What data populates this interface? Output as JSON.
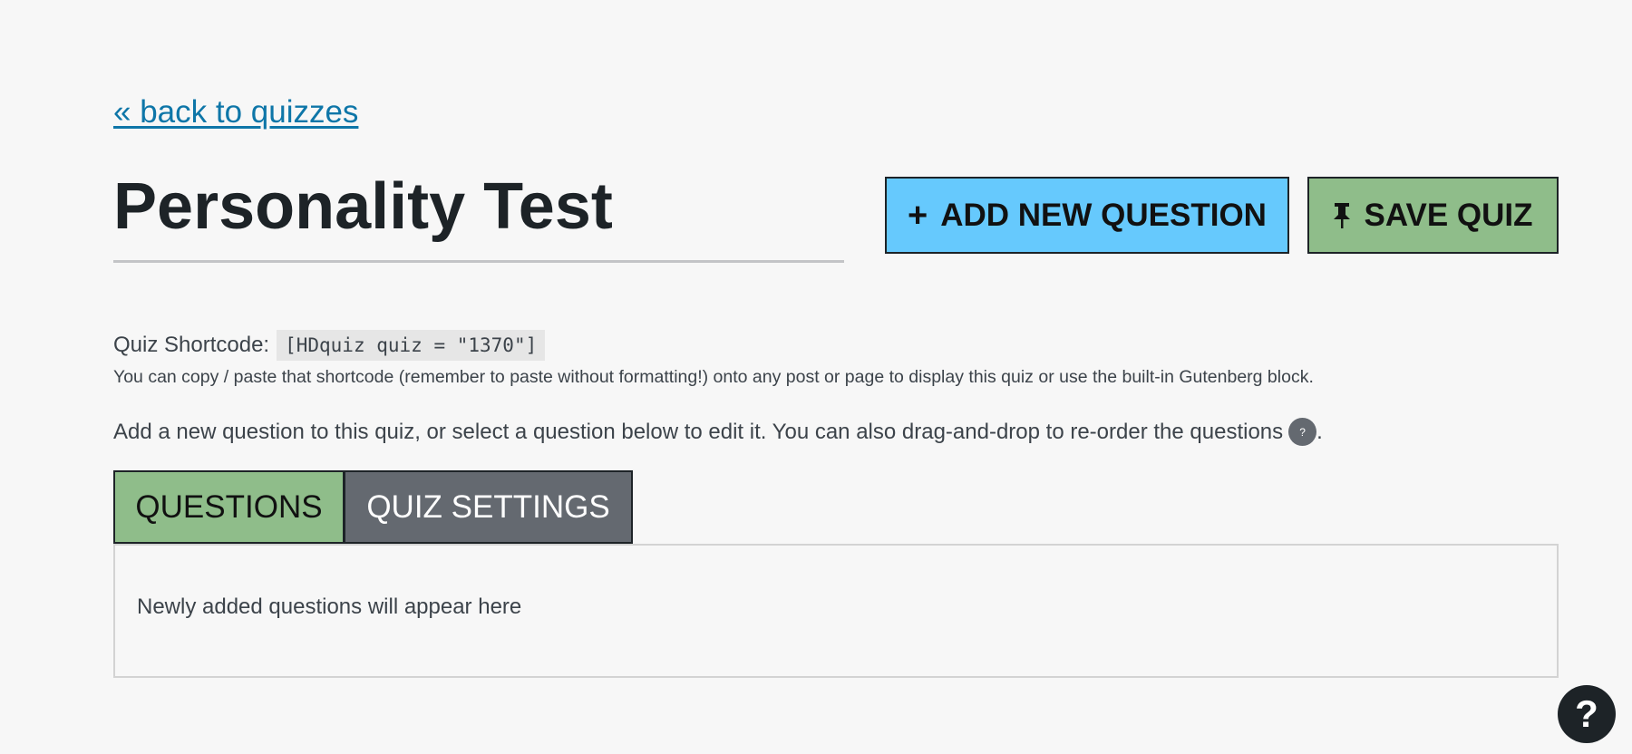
{
  "nav": {
    "back_link": "« back to quizzes"
  },
  "header": {
    "title": "Personality Test",
    "add_question_icon": "+",
    "add_question_label": "ADD NEW QUESTION",
    "save_icon": "pin-icon",
    "save_label": "SAVE QUIZ"
  },
  "shortcode": {
    "label": "Quiz Shortcode:",
    "code": "[HDquiz quiz = \"1370\"]",
    "help_text": "You can copy / paste that shortcode (remember to paste without formatting!) onto any post or page to display this quiz or use the built-in Gutenberg block."
  },
  "instructions": {
    "text": "Add a new question to this quiz, or select a question below to edit it. You can also drag-and-drop to re-order the questions",
    "help_icon_text": "?",
    "trailing": "."
  },
  "tabs": [
    {
      "label": "QUESTIONS",
      "active": true
    },
    {
      "label": "QUIZ SETTINGS",
      "active": false
    }
  ],
  "questions_panel": {
    "empty_message": "Newly added questions will appear here"
  },
  "help_fab": {
    "label": "?"
  },
  "colors": {
    "background": "#f7f7f7",
    "link": "#0e76a8",
    "add_button": "#66c9fd",
    "save_button": "#8fbd8a",
    "active_tab": "#8fbd8a",
    "inactive_tab": "#646970",
    "title": "#1d2327"
  }
}
